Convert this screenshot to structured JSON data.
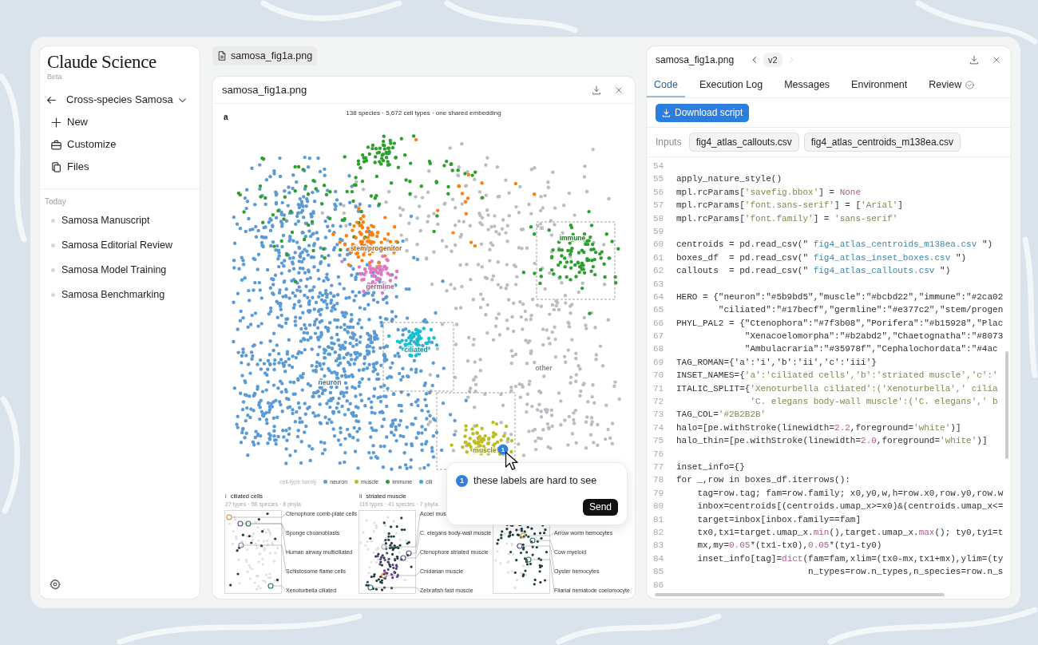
{
  "sidebar": {
    "app_title": "Claude Science",
    "badge": "Beta",
    "project": "Cross-species Samosa",
    "nav": [
      {
        "label": "New"
      },
      {
        "label": "Customize"
      },
      {
        "label": "Files"
      }
    ],
    "section": "Today",
    "sessions": [
      {
        "label": "Samosa Manuscript"
      },
      {
        "label": "Samosa Editorial Review"
      },
      {
        "label": "Samosa Model Training"
      },
      {
        "label": "Samosa Benchmarking"
      }
    ]
  },
  "file_tab": {
    "label": "samosa_fig1a.png"
  },
  "viewer": {
    "title": "samosa_fig1a.png",
    "figure": {
      "panel_letter": "a",
      "title": "138 species · 5,672 cell types · one shared embedding",
      "inset_regions": [
        {
          "tag": "iii"
        }
      ],
      "clusters": [
        {
          "label": "immune",
          "color": "#2ca02c"
        },
        {
          "label": "stem/progenitor",
          "color": "#ff7f0e"
        },
        {
          "label": "germline",
          "color": "#e377c2"
        },
        {
          "label": "ciliated",
          "color": "#17becf"
        },
        {
          "label": "other",
          "color": "#b9bdc2"
        },
        {
          "label": "neuron",
          "color": "#5b9bd5"
        },
        {
          "label": "muscle",
          "color": "#bcbd22"
        }
      ],
      "marker": {
        "number": "1"
      },
      "legend": {
        "title": "cell-type family",
        "items": [
          {
            "label": "neuron",
            "color": "#5b9bd5"
          },
          {
            "label": "muscle",
            "color": "#bcbd22"
          },
          {
            "label": "immune",
            "color": "#2ca02c"
          },
          {
            "label": "cili",
            "color": "#17becf"
          }
        ]
      },
      "insets": [
        {
          "tag": "i",
          "title": "ciliated cells",
          "subtitle": "27 types · 58 species · 8 phyla",
          "callouts": [
            "Ctenophore comb-plate cells",
            "Sponge choanoblasts",
            "Human airway multiciliated",
            "Schistosome flame cells",
            "Xenoturbella ciliated"
          ]
        },
        {
          "tag": "ii",
          "title": "striated muscle",
          "subtitle": "116 types · 41 species · 7 phyla",
          "callouts": [
            "Acoel mus",
            "C. elegans body-wall muscle",
            "Ctenophore striated muscle",
            "Cnidarian muscle",
            "Zebrafish fast muscle"
          ]
        },
        {
          "callouts": [
            "Arrow worm hemocytes",
            "Cow myeloid",
            "Oyster hemocytes",
            "Filarial nematode coelomocyte"
          ]
        }
      ]
    },
    "comment": {
      "number": "1",
      "text": "these labels are hard to see",
      "button": "Send"
    }
  },
  "details": {
    "title": "samosa_fig1a.png",
    "version": {
      "label": "v2",
      "previous_enabled": true,
      "next_enabled": false
    },
    "tabs": [
      {
        "label": "Code",
        "selected": true,
        "verified": false
      },
      {
        "label": "Execution Log",
        "selected": false,
        "verified": false
      },
      {
        "label": "Messages",
        "selected": false,
        "verified": false
      },
      {
        "label": "Environment",
        "selected": false,
        "verified": false
      },
      {
        "label": "Review",
        "selected": false,
        "verified": true
      }
    ],
    "download_button": "Download script",
    "inputs_label": "Inputs",
    "inputs": [
      "fig4_atlas_callouts.csv",
      "fig4_atlas_centroids_m138ea.csv"
    ],
    "code": [
      {
        "number": "54"
      },
      {
        "number": "55",
        "tokens": [
          {
            "kind": "code",
            "text": "apply_nature_style()"
          }
        ]
      },
      {
        "number": "56",
        "tokens": [
          {
            "kind": "code",
            "text": "mpl.rcParams["
          },
          {
            "kind": "string",
            "text": "'savefig.bbox'"
          },
          {
            "kind": "code",
            "text": "] = "
          },
          {
            "kind": "literal",
            "text": "None"
          }
        ]
      },
      {
        "number": "57",
        "tokens": [
          {
            "kind": "code",
            "text": "mpl.rcParams["
          },
          {
            "kind": "string",
            "text": "'font.sans-serif'"
          },
          {
            "kind": "code",
            "text": "] = ["
          },
          {
            "kind": "string",
            "text": "'Arial'"
          },
          {
            "kind": "code",
            "text": "]"
          }
        ]
      },
      {
        "number": "58",
        "tokens": [
          {
            "kind": "code",
            "text": "mpl.rcParams["
          },
          {
            "kind": "string",
            "text": "'font.family'"
          },
          {
            "kind": "code",
            "text": "] = "
          },
          {
            "kind": "string",
            "text": "'sans-serif'"
          }
        ]
      },
      {
        "number": "59"
      },
      {
        "number": "60",
        "tokens": [
          {
            "kind": "code",
            "text": "centroids = pd.read_csv(\" "
          },
          {
            "kind": "file",
            "text": "fig4_atlas_centroids_m138ea.csv"
          },
          {
            "kind": "code",
            "text": " \")"
          }
        ]
      },
      {
        "number": "61",
        "tokens": [
          {
            "kind": "code",
            "text": "boxes_df  = pd.read_csv(\" "
          },
          {
            "kind": "file",
            "text": "fig4_atlas_inset_boxes.csv"
          },
          {
            "kind": "code",
            "text": " \")"
          }
        ]
      },
      {
        "number": "62",
        "tokens": [
          {
            "kind": "code",
            "text": "callouts  = pd.read_csv(\" "
          },
          {
            "kind": "file",
            "text": "fig4_atlas_callouts.csv"
          },
          {
            "kind": "code",
            "text": " \")"
          }
        ]
      },
      {
        "number": "63"
      },
      {
        "number": "64",
        "tokens": [
          {
            "kind": "code",
            "text": "HERO = {\"neuron\":\"#5b9bd5\",\"muscle\":\"#bcbd22\",\"immune\":\"#2ca02"
          }
        ]
      },
      {
        "number": "65",
        "tokens": [
          {
            "kind": "code",
            "text": "        \"ciliated\":\"#17becf\",\"germline\":\"#e377c2\",\"stem/progen"
          }
        ]
      },
      {
        "number": "66",
        "tokens": [
          {
            "kind": "code",
            "text": "PHYL_PAL2 = {\"Ctenophora\":\"#7f3b08\",\"Porifera\":\"#b15928\",\"Plac"
          }
        ]
      },
      {
        "number": "67",
        "tokens": [
          {
            "kind": "code",
            "text": "             \"Xenacoelomorpha\":\"#b2abd2\",\"Chaetognatha\":\"#8073"
          }
        ]
      },
      {
        "number": "68",
        "tokens": [
          {
            "kind": "code",
            "text": "             \"Ambulacraria\":\"#35978f\",\"Cephalochordata\":\"#4ac"
          }
        ]
      },
      {
        "number": "69",
        "tokens": [
          {
            "kind": "code",
            "text": "TAG_ROMAN={'a':'i','b':'ii','c':'iii'}"
          }
        ]
      },
      {
        "number": "70",
        "tokens": [
          {
            "kind": "code",
            "text": "INSET_NAMES={"
          },
          {
            "kind": "string",
            "text": "'a':'ciliated cells','b':'striated muscle','c':'"
          }
        ]
      },
      {
        "number": "71",
        "tokens": [
          {
            "kind": "code",
            "text": "ITALIC_SPLIT={"
          },
          {
            "kind": "string",
            "text": "'Xenoturbella ciliated':('Xenoturbella',' cilia"
          }
        ]
      },
      {
        "number": "72",
        "tokens": [
          {
            "kind": "string",
            "text": "              'C. elegans body-wall muscle':('C. elegans',' b"
          }
        ]
      },
      {
        "number": "73",
        "tokens": [
          {
            "kind": "code",
            "text": "TAG_COL="
          },
          {
            "kind": "string",
            "text": "'#2B2B2B'"
          }
        ]
      },
      {
        "number": "74",
        "tokens": [
          {
            "kind": "code",
            "text": "halo=[pe.withStroke(linewidth="
          },
          {
            "kind": "literal",
            "text": "2.2"
          },
          {
            "kind": "code",
            "text": ",foreground="
          },
          {
            "kind": "string",
            "text": "'white'"
          },
          {
            "kind": "code",
            "text": ")]"
          }
        ]
      },
      {
        "number": "75",
        "tokens": [
          {
            "kind": "code",
            "text": "halo_thin=[pe.withStroke(linewidth="
          },
          {
            "kind": "literal",
            "text": "2.0"
          },
          {
            "kind": "code",
            "text": ",foreground="
          },
          {
            "kind": "string",
            "text": "'white'"
          },
          {
            "kind": "code",
            "text": ")]"
          }
        ]
      },
      {
        "number": "76"
      },
      {
        "number": "77",
        "tokens": [
          {
            "kind": "code",
            "text": "inset_info={}"
          }
        ]
      },
      {
        "number": "78",
        "tokens": [
          {
            "kind": "code",
            "text": "for _,row in boxes_df.iterrows():"
          }
        ]
      },
      {
        "number": "79",
        "tokens": [
          {
            "kind": "code",
            "text": "    tag=row.tag; fam=row.family; x0,y0,w,h=row.x0,row.y0,row.w"
          }
        ]
      },
      {
        "number": "80",
        "tokens": [
          {
            "kind": "code",
            "text": "    inbox=centroids[(centroids.umap_x>=x0)&(centroids.umap_x<="
          }
        ]
      },
      {
        "number": "81",
        "tokens": [
          {
            "kind": "code",
            "text": "    target=inbox[inbox.family==fam]"
          }
        ]
      },
      {
        "number": "82",
        "tokens": [
          {
            "kind": "code",
            "text": "    tx0,tx1=target.umap_x."
          },
          {
            "kind": "literal",
            "text": "min"
          },
          {
            "kind": "code",
            "text": "(),target.umap_x."
          },
          {
            "kind": "literal",
            "text": "max"
          },
          {
            "kind": "code",
            "text": "(); ty0,ty1=t"
          }
        ]
      },
      {
        "number": "83",
        "tokens": [
          {
            "kind": "code",
            "text": "    mx,my="
          },
          {
            "kind": "literal",
            "text": "0.05"
          },
          {
            "kind": "code",
            "text": "*(tx1-tx0),"
          },
          {
            "kind": "literal",
            "text": "0.05"
          },
          {
            "kind": "code",
            "text": "*(ty1-ty0)"
          }
        ]
      },
      {
        "number": "84",
        "tokens": [
          {
            "kind": "code",
            "text": "    inset_info[tag]="
          },
          {
            "kind": "literal",
            "text": "dict"
          },
          {
            "kind": "code",
            "text": "(fam=fam,xlim=(tx0-mx,tx1+mx),ylim=(ty"
          }
        ]
      },
      {
        "number": "85",
        "tokens": [
          {
            "kind": "code",
            "text": "                         n_types=row.n_types,n_species=row.n_s"
          }
        ]
      },
      {
        "number": "86"
      }
    ]
  }
}
